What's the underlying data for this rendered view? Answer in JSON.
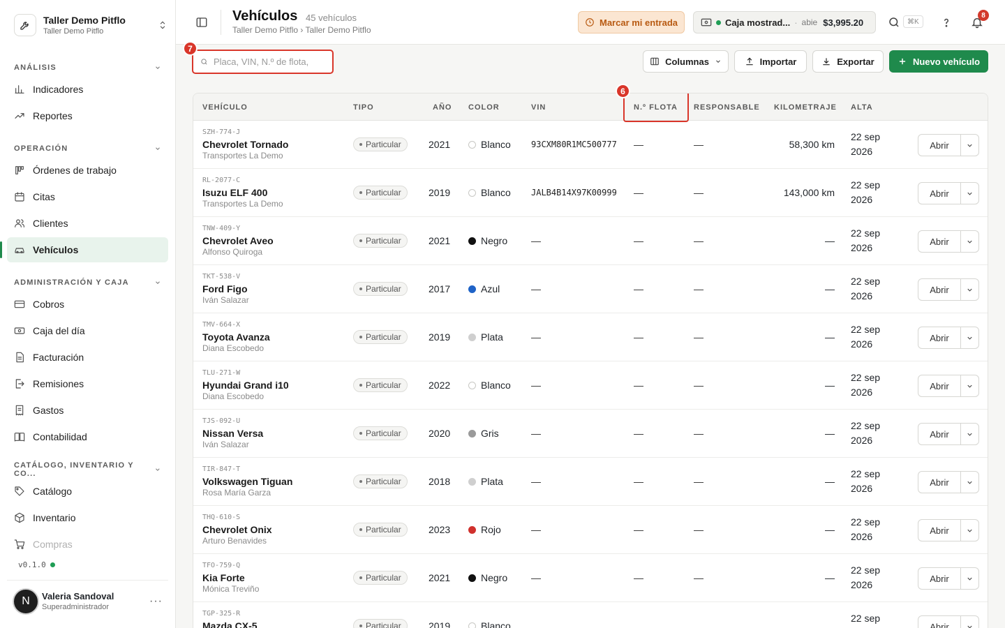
{
  "workspace": {
    "title": "Taller Demo Pitflo",
    "subtitle": "Taller Demo Pitflo"
  },
  "sidebar": {
    "sections": [
      {
        "title": "ANÁLISIS",
        "items": [
          {
            "label": "Indicadores",
            "icon": "bar-chart-icon"
          },
          {
            "label": "Reportes",
            "icon": "trend-icon"
          }
        ]
      },
      {
        "title": "OPERACIÓN",
        "items": [
          {
            "label": "Órdenes de trabajo",
            "icon": "kanban-icon"
          },
          {
            "label": "Citas",
            "icon": "calendar-icon"
          },
          {
            "label": "Clientes",
            "icon": "users-icon"
          },
          {
            "label": "Vehículos",
            "icon": "car-icon",
            "active": true
          }
        ]
      },
      {
        "title": "ADMINISTRACIÓN Y CAJA",
        "items": [
          {
            "label": "Cobros",
            "icon": "credit-card-icon"
          },
          {
            "label": "Caja del día",
            "icon": "cash-icon"
          },
          {
            "label": "Facturación",
            "icon": "invoice-icon"
          },
          {
            "label": "Remisiones",
            "icon": "file-export-icon"
          },
          {
            "label": "Gastos",
            "icon": "receipt-icon"
          },
          {
            "label": "Contabilidad",
            "icon": "book-icon"
          }
        ]
      },
      {
        "title": "CATÁLOGO, INVENTARIO Y CO...",
        "items": [
          {
            "label": "Catálogo",
            "icon": "tag-icon"
          },
          {
            "label": "Inventario",
            "icon": "box-icon"
          },
          {
            "label": "Compras",
            "icon": "cart-icon",
            "faded": true
          }
        ]
      }
    ],
    "version": "v0.1.0",
    "user": {
      "initial": "N",
      "name": "Valeria Sandoval",
      "role": "Superadministrador"
    }
  },
  "header": {
    "title": "Vehículos",
    "count": "45 vehículos",
    "breadcrumb": "Taller Demo Pitflo › Taller Demo Pitflo",
    "entry_label": "Marcar mi entrada",
    "cash": {
      "name": "Caja mostrad...",
      "status": "abie",
      "amount": "$3,995.20"
    },
    "shortcut": "⌘K",
    "notifications": "8"
  },
  "toolbar": {
    "search_placeholder": "Placa, VIN, N.º de flota,",
    "columns_label": "Columnas",
    "import_label": "Importar",
    "export_label": "Exportar",
    "new_label": "Nuevo vehículo"
  },
  "callouts": {
    "search": "7",
    "fleet": "6"
  },
  "table": {
    "headers": {
      "vehicle": "VEHÍCULO",
      "type": "TIPO",
      "year": "AÑO",
      "color": "COLOR",
      "vin": "VIN",
      "fleet": "N.º FLOTA",
      "owner": "RESPONSABLE",
      "km": "KILOMETRAJE",
      "alta": "ALTA"
    },
    "open_label": "Abrir",
    "rows": [
      {
        "plate": "SZH-774-J",
        "model": "Chevrolet Tornado",
        "owner": "Transportes La Demo",
        "type": "Particular",
        "year": "2021",
        "color": "Blanco",
        "swatch": "#ffffff",
        "vin": "93CXM80R1MC500777",
        "fleet": "—",
        "responsible": "—",
        "km": "58,300 km",
        "alta1": "22 sep",
        "alta2": "2026"
      },
      {
        "plate": "RL-2077-C",
        "model": "Isuzu ELF 400",
        "owner": "Transportes La Demo",
        "type": "Particular",
        "year": "2019",
        "color": "Blanco",
        "swatch": "#ffffff",
        "vin": "JALB4B14X97K00999",
        "fleet": "—",
        "responsible": "—",
        "km": "143,000 km",
        "alta1": "22 sep",
        "alta2": "2026"
      },
      {
        "plate": "TNW-409-Y",
        "model": "Chevrolet Aveo",
        "owner": "Alfonso Quiroga",
        "type": "Particular",
        "year": "2021",
        "color": "Negro",
        "swatch": "#111111",
        "vin": "—",
        "fleet": "—",
        "responsible": "—",
        "km": "—",
        "alta1": "22 sep",
        "alta2": "2026"
      },
      {
        "plate": "TKT-538-V",
        "model": "Ford Figo",
        "owner": "Iván Salazar",
        "type": "Particular",
        "year": "2017",
        "color": "Azul",
        "swatch": "#1f63c7",
        "vin": "—",
        "fleet": "—",
        "responsible": "—",
        "km": "—",
        "alta1": "22 sep",
        "alta2": "2026"
      },
      {
        "plate": "TMV-664-X",
        "model": "Toyota Avanza",
        "owner": "Diana Escobedo",
        "type": "Particular",
        "year": "2019",
        "color": "Plata",
        "swatch": "#cfcfcf",
        "vin": "—",
        "fleet": "—",
        "responsible": "—",
        "km": "—",
        "alta1": "22 sep",
        "alta2": "2026"
      },
      {
        "plate": "TLU-271-W",
        "model": "Hyundai Grand i10",
        "owner": "Diana Escobedo",
        "type": "Particular",
        "year": "2022",
        "color": "Blanco",
        "swatch": "#ffffff",
        "vin": "—",
        "fleet": "—",
        "responsible": "—",
        "km": "—",
        "alta1": "22 sep",
        "alta2": "2026"
      },
      {
        "plate": "TJS-092-U",
        "model": "Nissan Versa",
        "owner": "Iván Salazar",
        "type": "Particular",
        "year": "2020",
        "color": "Gris",
        "swatch": "#9a9a9a",
        "vin": "—",
        "fleet": "—",
        "responsible": "—",
        "km": "—",
        "alta1": "22 sep",
        "alta2": "2026"
      },
      {
        "plate": "TIR-847-T",
        "model": "Volkswagen Tiguan",
        "owner": "Rosa María Garza",
        "type": "Particular",
        "year": "2018",
        "color": "Plata",
        "swatch": "#cfcfcf",
        "vin": "—",
        "fleet": "—",
        "responsible": "—",
        "km": "—",
        "alta1": "22 sep",
        "alta2": "2026"
      },
      {
        "plate": "THQ-610-S",
        "model": "Chevrolet Onix",
        "owner": "Arturo Benavides",
        "type": "Particular",
        "year": "2023",
        "color": "Rojo",
        "swatch": "#d0312d",
        "vin": "—",
        "fleet": "—",
        "responsible": "—",
        "km": "—",
        "alta1": "22 sep",
        "alta2": "2026"
      },
      {
        "plate": "TFO-759-Q",
        "model": "Kia Forte",
        "owner": "Mónica Treviño",
        "type": "Particular",
        "year": "2021",
        "color": "Negro",
        "swatch": "#111111",
        "vin": "—",
        "fleet": "—",
        "responsible": "—",
        "km": "—",
        "alta1": "22 sep",
        "alta2": "2026"
      },
      {
        "plate": "TGP-325-R",
        "model": "Mazda CX-5",
        "owner": "",
        "type": "Particular",
        "year": "2019",
        "color": "Blanco",
        "swatch": "#ffffff",
        "vin": "",
        "fleet": "",
        "responsible": "",
        "km": "",
        "alta1": "22 sep",
        "alta2": ""
      }
    ]
  }
}
